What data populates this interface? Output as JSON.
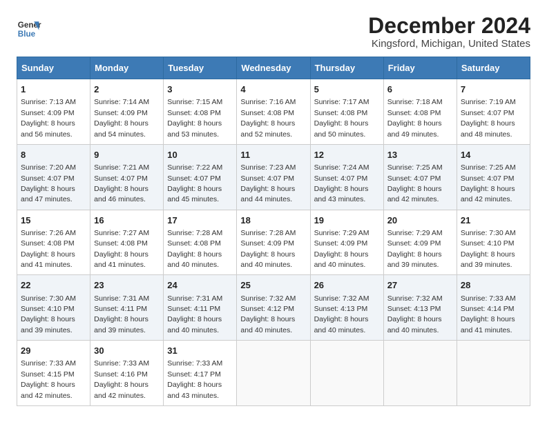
{
  "logo": {
    "line1": "General",
    "line2": "Blue"
  },
  "title": "December 2024",
  "subtitle": "Kingsford, Michigan, United States",
  "colors": {
    "header_bg": "#3d7ab5",
    "accent": "#2d6aa0"
  },
  "days_of_week": [
    "Sunday",
    "Monday",
    "Tuesday",
    "Wednesday",
    "Thursday",
    "Friday",
    "Saturday"
  ],
  "weeks": [
    [
      {
        "day": "1",
        "detail": "Sunrise: 7:13 AM\nSunset: 4:09 PM\nDaylight: 8 hours\nand 56 minutes."
      },
      {
        "day": "2",
        "detail": "Sunrise: 7:14 AM\nSunset: 4:09 PM\nDaylight: 8 hours\nand 54 minutes."
      },
      {
        "day": "3",
        "detail": "Sunrise: 7:15 AM\nSunset: 4:08 PM\nDaylight: 8 hours\nand 53 minutes."
      },
      {
        "day": "4",
        "detail": "Sunrise: 7:16 AM\nSunset: 4:08 PM\nDaylight: 8 hours\nand 52 minutes."
      },
      {
        "day": "5",
        "detail": "Sunrise: 7:17 AM\nSunset: 4:08 PM\nDaylight: 8 hours\nand 50 minutes."
      },
      {
        "day": "6",
        "detail": "Sunrise: 7:18 AM\nSunset: 4:08 PM\nDaylight: 8 hours\nand 49 minutes."
      },
      {
        "day": "7",
        "detail": "Sunrise: 7:19 AM\nSunset: 4:07 PM\nDaylight: 8 hours\nand 48 minutes."
      }
    ],
    [
      {
        "day": "8",
        "detail": "Sunrise: 7:20 AM\nSunset: 4:07 PM\nDaylight: 8 hours\nand 47 minutes."
      },
      {
        "day": "9",
        "detail": "Sunrise: 7:21 AM\nSunset: 4:07 PM\nDaylight: 8 hours\nand 46 minutes."
      },
      {
        "day": "10",
        "detail": "Sunrise: 7:22 AM\nSunset: 4:07 PM\nDaylight: 8 hours\nand 45 minutes."
      },
      {
        "day": "11",
        "detail": "Sunrise: 7:23 AM\nSunset: 4:07 PM\nDaylight: 8 hours\nand 44 minutes."
      },
      {
        "day": "12",
        "detail": "Sunrise: 7:24 AM\nSunset: 4:07 PM\nDaylight: 8 hours\nand 43 minutes."
      },
      {
        "day": "13",
        "detail": "Sunrise: 7:25 AM\nSunset: 4:07 PM\nDaylight: 8 hours\nand 42 minutes."
      },
      {
        "day": "14",
        "detail": "Sunrise: 7:25 AM\nSunset: 4:07 PM\nDaylight: 8 hours\nand 42 minutes."
      }
    ],
    [
      {
        "day": "15",
        "detail": "Sunrise: 7:26 AM\nSunset: 4:08 PM\nDaylight: 8 hours\nand 41 minutes."
      },
      {
        "day": "16",
        "detail": "Sunrise: 7:27 AM\nSunset: 4:08 PM\nDaylight: 8 hours\nand 41 minutes."
      },
      {
        "day": "17",
        "detail": "Sunrise: 7:28 AM\nSunset: 4:08 PM\nDaylight: 8 hours\nand 40 minutes."
      },
      {
        "day": "18",
        "detail": "Sunrise: 7:28 AM\nSunset: 4:09 PM\nDaylight: 8 hours\nand 40 minutes."
      },
      {
        "day": "19",
        "detail": "Sunrise: 7:29 AM\nSunset: 4:09 PM\nDaylight: 8 hours\nand 40 minutes."
      },
      {
        "day": "20",
        "detail": "Sunrise: 7:29 AM\nSunset: 4:09 PM\nDaylight: 8 hours\nand 39 minutes."
      },
      {
        "day": "21",
        "detail": "Sunrise: 7:30 AM\nSunset: 4:10 PM\nDaylight: 8 hours\nand 39 minutes."
      }
    ],
    [
      {
        "day": "22",
        "detail": "Sunrise: 7:30 AM\nSunset: 4:10 PM\nDaylight: 8 hours\nand 39 minutes."
      },
      {
        "day": "23",
        "detail": "Sunrise: 7:31 AM\nSunset: 4:11 PM\nDaylight: 8 hours\nand 39 minutes."
      },
      {
        "day": "24",
        "detail": "Sunrise: 7:31 AM\nSunset: 4:11 PM\nDaylight: 8 hours\nand 40 minutes."
      },
      {
        "day": "25",
        "detail": "Sunrise: 7:32 AM\nSunset: 4:12 PM\nDaylight: 8 hours\nand 40 minutes."
      },
      {
        "day": "26",
        "detail": "Sunrise: 7:32 AM\nSunset: 4:13 PM\nDaylight: 8 hours\nand 40 minutes."
      },
      {
        "day": "27",
        "detail": "Sunrise: 7:32 AM\nSunset: 4:13 PM\nDaylight: 8 hours\nand 40 minutes."
      },
      {
        "day": "28",
        "detail": "Sunrise: 7:33 AM\nSunset: 4:14 PM\nDaylight: 8 hours\nand 41 minutes."
      }
    ],
    [
      {
        "day": "29",
        "detail": "Sunrise: 7:33 AM\nSunset: 4:15 PM\nDaylight: 8 hours\nand 42 minutes."
      },
      {
        "day": "30",
        "detail": "Sunrise: 7:33 AM\nSunset: 4:16 PM\nDaylight: 8 hours\nand 42 minutes."
      },
      {
        "day": "31",
        "detail": "Sunrise: 7:33 AM\nSunset: 4:17 PM\nDaylight: 8 hours\nand 43 minutes."
      },
      {
        "day": "",
        "detail": ""
      },
      {
        "day": "",
        "detail": ""
      },
      {
        "day": "",
        "detail": ""
      },
      {
        "day": "",
        "detail": ""
      }
    ]
  ]
}
